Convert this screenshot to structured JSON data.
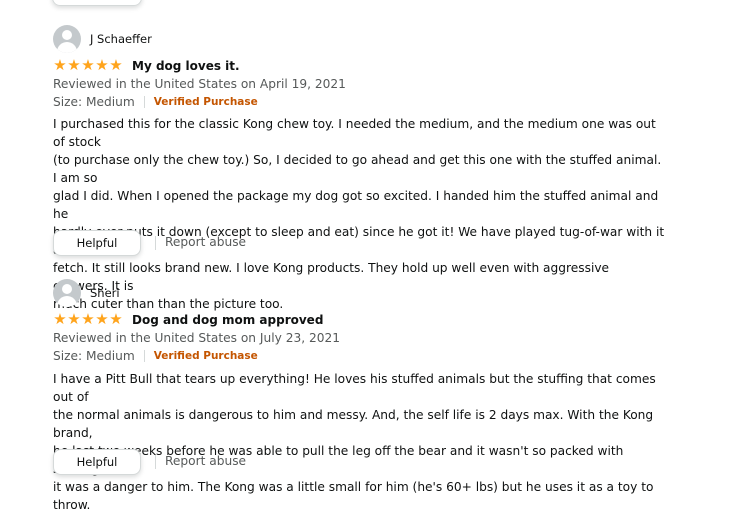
{
  "reviews": [
    {
      "reviewer": "J Schaeffer",
      "rating": 5,
      "title": "My dog loves it.",
      "date_line": "Reviewed in the United States on April 19, 2021",
      "size": "Size: Medium",
      "verified": "Verified Purchase",
      "lines": [
        "I purchased this for the classic Kong chew toy. I needed the medium, and the medium one was out of stock",
        "(to purchase only the chew toy.) So, I decided to go ahead and get this one with the stuffed animal. I am so",
        "glad I did. When I opened the package my dog got so excited. I handed him the stuffed animal and he",
        "hardly ever puts it down (except to sleep and eat) since he got it! We have played tug-of-war with it and",
        "fetch. It still looks brand new. I love Kong products. They hold up well even with aggressive chewers. It is",
        "much cuter than than the picture too."
      ],
      "helpful_label": "Helpful",
      "report_label": "Report abuse"
    },
    {
      "reviewer": "Sheri",
      "rating": 5,
      "title": "Dog and dog mom approved",
      "date_line": "Reviewed in the United States on July 23, 2021",
      "size": "Size: Medium",
      "verified": "Verified Purchase",
      "lines": [
        "I have a Pitt Bull that tears up everything! He loves his stuffed animals but the stuffing that comes out of",
        "the normal animals is dangerous to him and messy. And, the self life is 2 days max. With the Kong brand,",
        "he last two weeks before he was able to pull the leg off the bear and it wasn't so packed with stuffing that",
        "it was a danger to him. The Kong was a little small for him (he's 60+ lbs) but he uses it as a toy to throw."
      ],
      "helpful_label": "Helpful",
      "report_label": "Report abuse"
    }
  ],
  "colors": {
    "star": "#ffa41c",
    "verified": "#c45500",
    "muted_text": "#565959",
    "text": "#0f1111"
  }
}
